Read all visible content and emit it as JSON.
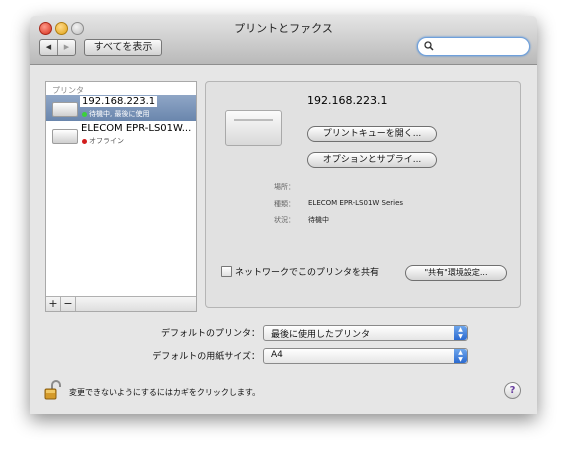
{
  "window": {
    "title": "プリントとファクス"
  },
  "toolbar": {
    "back_glyph": "◀",
    "forward_glyph": "▶",
    "show_all_label": "すべてを表示",
    "search_value": "",
    "search_glyph": "🔍"
  },
  "printer_list": {
    "header": "プリンタ",
    "items": [
      {
        "name": "192.168.223.1",
        "status": "待機中, 最後に使用",
        "status_color": "#3bd13b",
        "selected": true
      },
      {
        "name": "ELECOM EPR-LS01W...",
        "status": "オフライン",
        "status_color": "#d21d1d",
        "selected": false
      }
    ],
    "add_label": "+",
    "remove_label": "−"
  },
  "detail": {
    "printer_name": "192.168.223.1",
    "open_queue_label": "プリントキューを開く...",
    "options_label": "オプションとサプライ...",
    "location_label": "場所：",
    "location_value": "",
    "kind_label": "種類：",
    "kind_value": "ELECOM EPR-LS01W Series",
    "status_label": "状況：",
    "status_value": "待機中",
    "share_label": "ネットワークでこのプリンタを共有",
    "share_checked": false,
    "sharing_prefs_label": "\"共有\"環境設定..."
  },
  "defaults": {
    "default_printer_label": "デフォルトのプリンタ：",
    "default_printer_value": "最後に使用したプリンタ",
    "default_paper_label": "デフォルトの用紙サイズ：",
    "default_paper_value": "A4",
    "popup_arrow_glyph": "▲▼"
  },
  "footer": {
    "lock_text": "変更できないようにするにはカギをクリックします。",
    "help_glyph": "?"
  },
  "colors": {
    "selection": "#7a93b8",
    "popup_accent": "#2b6ad0",
    "window_bg": "#e6e6e6"
  }
}
